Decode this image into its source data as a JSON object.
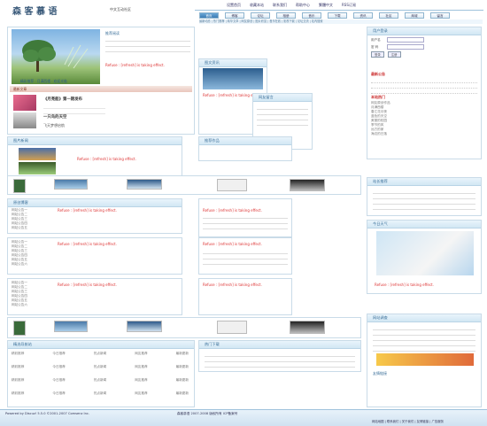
{
  "header": {
    "logo_text": "森 客 慕 语",
    "slogan": "中文互动社区",
    "top_links": [
      "设置首页",
      "收藏本站",
      "联系我们",
      "帮助中心",
      "繁體中文",
      "RSS订阅"
    ],
    "tabs": [
      "首页",
      "博客",
      "论坛",
      "相册",
      "音乐",
      "下载",
      "资讯",
      "社区",
      "商城",
      "留言"
    ],
    "sub_nav": "最新动态 | 热门推荐 | 精华文章 | 网友原创 | 图片欣赏 | 音乐在线 | 影视下载 | 论坛交流 | 站内搜索"
  },
  "errors": {
    "text": "Refuse : [refresh] is taking effect."
  },
  "left": {
    "feature_caption": "精彩推荐 · 月满西楼 · 欢迎光临",
    "section1_title": "最新文章",
    "article_titles": [
      "《月亮船》第一期发布",
      "一只鸟的天空",
      "飞天梦想启航"
    ],
    "section_pics_title": "图片新闻",
    "blog_title": "原创博客",
    "list_items": [
      "网站公告一",
      "网站公告二",
      "网站公告三",
      "网站公告四",
      "网站公告五",
      "网站公告六"
    ]
  },
  "mid": {
    "top_title": "推荐阅读",
    "news_title": "图文资讯",
    "float_title": "网友留言",
    "section_titles": [
      "推荐作品",
      "最新更新",
      "热门下载"
    ]
  },
  "right": {
    "login_title": "用户登录",
    "login_user_label": "用户名",
    "login_pass_label": "密 码",
    "login_button": "登录",
    "register_button": "注册",
    "news_title": "最新公告",
    "hot_title": "本站热门",
    "hot_items": [
      "网友原创作品",
      "月满西楼",
      "春江花月夜",
      "蓝色的天空",
      "美丽的校园",
      "季节的风",
      "远方的家",
      "海边的日落"
    ],
    "links_title": "站长推荐",
    "vote_title": "网站调查",
    "weather_title": "今日天气",
    "footer_panel_title": "友情链接"
  },
  "bottom": {
    "friends_title": "精选导航站",
    "friends_rows": [
      [
        "精彩推荐",
        "今日推荐",
        "热点新闻",
        "网友推荐",
        "最新更新"
      ],
      [
        "精彩推荐",
        "今日推荐",
        "热点新闻",
        "网友推荐",
        "最新更新"
      ],
      [
        "精彩推荐",
        "今日推荐",
        "热点新闻",
        "网友推荐",
        "最新更新"
      ],
      [
        "精彩推荐",
        "今日推荐",
        "热点新闻",
        "网友推荐",
        "最新更新"
      ]
    ]
  },
  "footer": {
    "powered": "Powered by Discuz! 5.5.0 ©2001-2007 Comsenz Inc.",
    "center_text": "森客慕语 2007-2008 版权所有 ICP备案号",
    "right_links": "网站地图 | 联系我们 | 关于我们 | 友情链接 | 广告服务"
  },
  "colors": {
    "accent": "#3d7cb4",
    "panel_border": "#c9dbe8",
    "error_red": "#dd3333"
  }
}
